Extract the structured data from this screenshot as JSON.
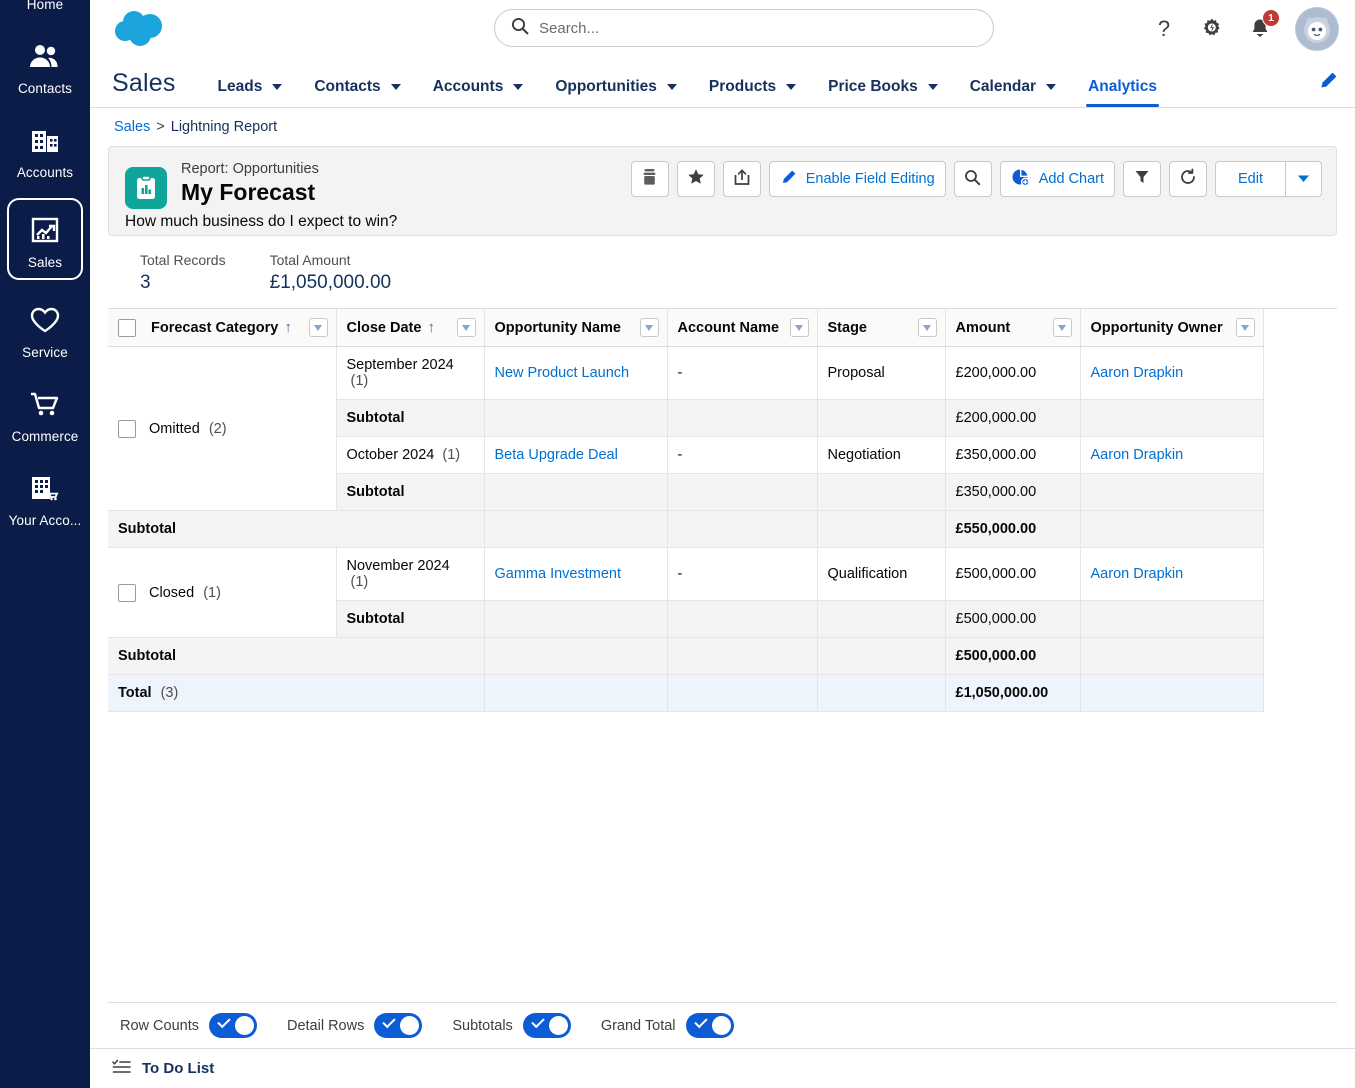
{
  "rail": {
    "items": [
      {
        "label": "Home",
        "icon": "home-icon",
        "selected": false
      },
      {
        "label": "Contacts",
        "icon": "contacts-icon",
        "selected": false
      },
      {
        "label": "Accounts",
        "icon": "accounts-icon",
        "selected": false
      },
      {
        "label": "Sales",
        "icon": "sales-chart-icon",
        "selected": true
      },
      {
        "label": "Service",
        "icon": "heart-icon",
        "selected": false
      },
      {
        "label": "Commerce",
        "icon": "cart-icon",
        "selected": false
      },
      {
        "label": "Your Acco...",
        "icon": "your-account-icon",
        "selected": false
      }
    ]
  },
  "header": {
    "logo": "salesforce-cloud-logo",
    "search": {
      "placeholder": "Search...",
      "value": "",
      "icon": "search-icon"
    },
    "help_icon": "question-mark-icon",
    "setup_icon": "gear-icon",
    "notifications_icon": "bell-icon",
    "notifications_count": "1",
    "avatar": "user-avatar"
  },
  "appnav": {
    "app_name": "Sales",
    "tabs": [
      {
        "label": "Leads",
        "has_caret": true,
        "active": false
      },
      {
        "label": "Contacts",
        "has_caret": true,
        "active": false
      },
      {
        "label": "Accounts",
        "has_caret": true,
        "active": false
      },
      {
        "label": "Opportunities",
        "has_caret": true,
        "active": false
      },
      {
        "label": "Products",
        "has_caret": true,
        "active": false
      },
      {
        "label": "Price Books",
        "has_caret": true,
        "active": false
      },
      {
        "label": "Calendar",
        "has_caret": true,
        "active": false
      },
      {
        "label": "Analytics",
        "has_caret": false,
        "active": true
      }
    ],
    "edit_icon": "pencil-icon"
  },
  "breadcrumb": {
    "root": "Sales",
    "separator": ">",
    "current": "Lightning Report"
  },
  "report": {
    "icon": "report-clipboard-icon",
    "kicker": "Report: Opportunities",
    "title": "My Forecast",
    "description": "How much business do I expect to win?",
    "toolbar": {
      "archive_icon": "archive-icon",
      "favorite_icon": "star-icon",
      "share_icon": "share-icon",
      "field_editing_label": "Enable Field Editing",
      "field_editing_icon": "pencil-icon",
      "search_icon": "search-icon",
      "add_chart_label": "Add Chart",
      "add_chart_icon": "pie-chart-icon",
      "filter_icon": "funnel-icon",
      "refresh_icon": "refresh-icon",
      "edit_label": "Edit",
      "edit_dropdown_icon": "chevron-down-icon"
    }
  },
  "stats": {
    "total_records_label": "Total Records",
    "total_records_value": "3",
    "total_amount_label": "Total Amount",
    "total_amount_value": "£1,050,000.00"
  },
  "table": {
    "columns": [
      {
        "label": "Forecast Category",
        "sorted": true,
        "sort_dir": "asc",
        "has_checkbox": true
      },
      {
        "label": "Close Date",
        "sorted": true,
        "sort_dir": "asc",
        "has_checkbox": false
      },
      {
        "label": "Opportunity Name",
        "sorted": false,
        "has_checkbox": false
      },
      {
        "label": "Account Name",
        "sorted": false,
        "has_checkbox": false
      },
      {
        "label": "Stage",
        "sorted": false,
        "has_checkbox": false
      },
      {
        "label": "Amount",
        "sorted": false,
        "has_checkbox": false
      },
      {
        "label": "Opportunity Owner",
        "sorted": false,
        "has_checkbox": false
      }
    ],
    "groups": [
      {
        "name": "Omitted",
        "count": "(2)",
        "rows": [
          {
            "type": "detail",
            "close_date": "September 2024",
            "close_date_count": "(1)",
            "opportunity_name": "New Product Launch",
            "account_name": "-",
            "stage": "Proposal",
            "amount": "£200,000.00",
            "owner": "Aaron Drapkin"
          },
          {
            "type": "subtotal",
            "label": "Subtotal",
            "amount": "£200,000.00"
          },
          {
            "type": "detail",
            "close_date": "October 2024",
            "close_date_count": "(1)",
            "opportunity_name": "Beta Upgrade Deal",
            "account_name": "-",
            "stage": "Negotiation",
            "amount": "£350,000.00",
            "owner": "Aaron Drapkin"
          },
          {
            "type": "subtotal",
            "label": "Subtotal",
            "amount": "£350,000.00"
          }
        ],
        "group_subtotal": {
          "label": "Subtotal",
          "amount": "£550,000.00"
        }
      },
      {
        "name": "Closed",
        "count": "(1)",
        "rows": [
          {
            "type": "detail",
            "close_date": "November 2024",
            "close_date_count": "(1)",
            "opportunity_name": "Gamma Investment",
            "account_name": "-",
            "stage": "Qualification",
            "amount": "£500,000.00",
            "owner": "Aaron Drapkin"
          },
          {
            "type": "subtotal",
            "label": "Subtotal",
            "amount": "£500,000.00"
          }
        ],
        "group_subtotal": {
          "label": "Subtotal",
          "amount": "£500,000.00"
        }
      }
    ],
    "total": {
      "label": "Total",
      "count": "(3)",
      "amount": "£1,050,000.00"
    }
  },
  "footer": {
    "toggles": [
      {
        "label": "Row Counts",
        "on": true
      },
      {
        "label": "Detail Rows",
        "on": true
      },
      {
        "label": "Subtotals",
        "on": true
      },
      {
        "label": "Grand Total",
        "on": true
      }
    ]
  },
  "utility": {
    "label": "To Do List",
    "icon": "checklist-icon"
  },
  "colors": {
    "rail_bg": "#0b1c48",
    "link": "#0070d2",
    "accent": "#0b5cd5",
    "report_icon": "#0fa59a",
    "badge": "#c23934",
    "total_row": "#eef4fb"
  }
}
